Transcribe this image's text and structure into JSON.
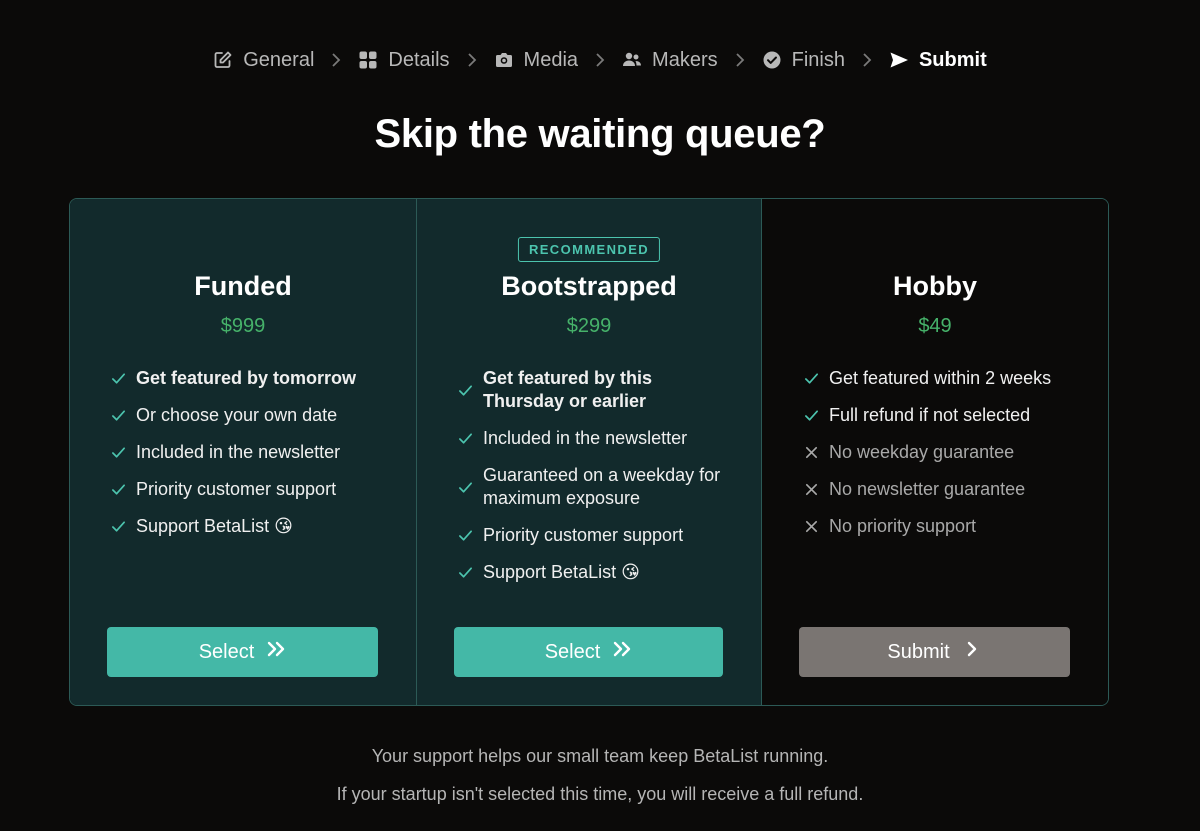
{
  "steps": [
    {
      "label": "General",
      "icon": "edit-icon"
    },
    {
      "label": "Details",
      "icon": "grid-icon"
    },
    {
      "label": "Media",
      "icon": "camera-icon"
    },
    {
      "label": "Makers",
      "icon": "users-icon"
    },
    {
      "label": "Finish",
      "icon": "check-circle-icon"
    },
    {
      "label": "Submit",
      "icon": "send-icon",
      "current": true
    }
  ],
  "title": "Skip the waiting queue?",
  "plans": [
    {
      "name": "Funded",
      "price": "$999",
      "features": [
        {
          "text": "Get featured by tomorrow",
          "included": true,
          "bold": true
        },
        {
          "text": "Or choose your own date",
          "included": true
        },
        {
          "text": "Included in the newsletter",
          "included": true
        },
        {
          "text": "Priority customer support",
          "included": true
        },
        {
          "text": "Support BetaList 😘",
          "included": true
        }
      ],
      "button": "Select"
    },
    {
      "badge": "RECOMMENDED",
      "name": "Bootstrapped",
      "price": "$299",
      "features": [
        {
          "text": "Get featured by this Thursday or earlier",
          "included": true,
          "bold": true
        },
        {
          "text": "Included in the newsletter",
          "included": true
        },
        {
          "text": "Guaranteed on a weekday for maximum exposure",
          "included": true
        },
        {
          "text": "Priority customer support",
          "included": true
        },
        {
          "text": "Support BetaList 😘",
          "included": true
        }
      ],
      "button": "Select"
    },
    {
      "name": "Hobby",
      "price": "$49",
      "features": [
        {
          "text": "Get featured within 2 weeks",
          "included": true
        },
        {
          "text": "Full refund if not selected",
          "included": true
        },
        {
          "text": "No weekday guarantee",
          "included": false
        },
        {
          "text": "No newsletter guarantee",
          "included": false
        },
        {
          "text": "No priority support",
          "included": false
        }
      ],
      "button": "Submit"
    }
  ],
  "footer": {
    "line1": "Your support helps our small team keep BetaList running.",
    "line2": "If your startup isn't selected this time, you will receive a full refund."
  },
  "colors": {
    "background": "#0b0a09",
    "card": "#122a2c",
    "border": "#2c5a56",
    "accent": "#44b8a7",
    "price": "#46b26a",
    "muted_button": "#7a7572"
  }
}
